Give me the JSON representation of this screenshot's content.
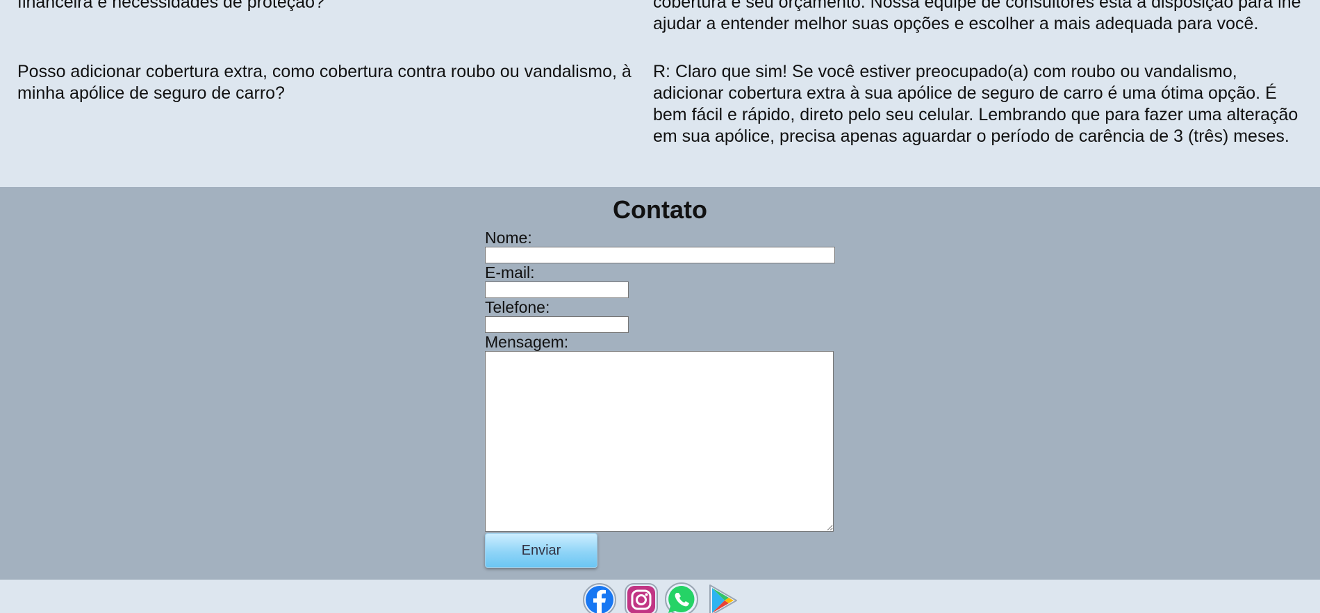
{
  "faq": [
    {
      "question": "financeira e necessidades de proteção?",
      "answer": "cobertura e seu orçamento. Nossa equipe de consultores está à disposição para lhe ajudar a entender melhor suas opções e escolher a mais adequada para você."
    },
    {
      "question": "Posso adicionar cobertura extra, como cobertura contra roubo ou vandalismo, à minha apólice de seguro de carro?",
      "answer": "R: Claro que sim! Se você estiver preocupado(a) com roubo ou vandalismo, adicionar cobertura extra à sua apólice de seguro de carro é uma ótima opção. É bem fácil e rápido, direto pelo seu celular. Lembrando que para fazer uma alteração em sua apólice, precisa apenas aguardar o período de carência de 3 (três) meses."
    }
  ],
  "contact": {
    "title": "Contato",
    "name_label": "Nome:",
    "name_value": "",
    "email_label": "E-mail:",
    "email_value": "",
    "phone_label": "Telefone:",
    "phone_value": "",
    "message_label": "Mensagem:",
    "message_value": "",
    "submit_label": "Enviar"
  },
  "footer": {
    "social_icons": [
      "facebook-icon",
      "instagram-icon",
      "whatsapp-icon",
      "google-play-icon"
    ]
  },
  "colors": {
    "faq_background": "#dde6ef",
    "contact_background": "#a3b1bf",
    "button_gradient": "#8fd4f7",
    "facebook": "#1877f2",
    "instagram": "#c13584",
    "whatsapp": "#25d366"
  }
}
